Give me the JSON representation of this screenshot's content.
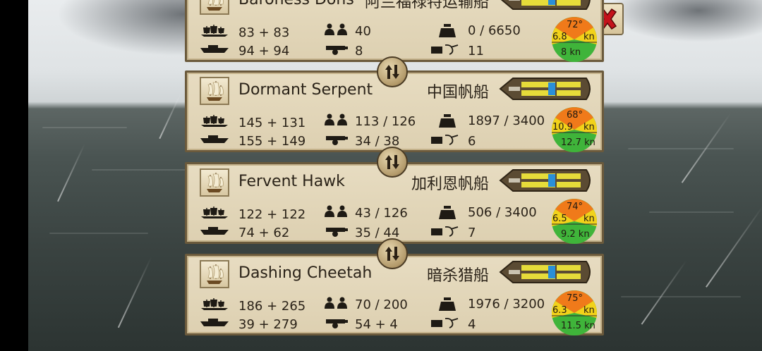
{
  "close": {
    "icon": "close-x-icon"
  },
  "ships": [
    {
      "name": "Baroness Dons",
      "type": "阿兰福禄特运输船",
      "crew_cur": "83 + 83",
      "hull_cur": "94 + 94",
      "sailors": "40",
      "cannons": "8",
      "cargo": "0 / 6650",
      "supplies": "11",
      "angle": "72°",
      "speed_low": "6.8",
      "speed_unit": "kn",
      "speed_max": "8 kn"
    },
    {
      "name": "Dormant Serpent",
      "type": "中国帆船",
      "crew_cur": "145 + 131",
      "hull_cur": "155 + 149",
      "sailors": "113 / 126",
      "cannons": "34 / 38",
      "cargo": "1897 / 3400",
      "supplies": "6",
      "angle": "68°",
      "speed_low": "10.9",
      "speed_unit": "kn",
      "speed_max": "12.7 kn"
    },
    {
      "name": "Fervent Hawk",
      "type": "加利恩帆船",
      "crew_cur": "122 + 122",
      "hull_cur": "74 + 62",
      "sailors": "43 / 126",
      "cannons": "35 / 44",
      "cargo": "506 / 3400",
      "supplies": "7",
      "angle": "74°",
      "speed_low": "6.5",
      "speed_unit": "kn",
      "speed_max": "9.2 kn"
    },
    {
      "name": "Dashing Cheetah",
      "type": "暗杀猎船",
      "crew_cur": "186 + 265",
      "hull_cur": "39 + 279",
      "sailors": "70 / 200",
      "cannons": "54 + 4",
      "cargo": "1976 / 3200",
      "supplies": "4",
      "angle": "75°",
      "speed_low": "6.3",
      "speed_unit": "kn",
      "speed_max": "11.5 kn"
    }
  ],
  "colors": {
    "panel_bg": "#e3d8bc",
    "panel_border": "#6b5a3c",
    "speed_orange": "#f07a1a",
    "speed_yellow": "#f2d21a",
    "speed_green": "#3fb43a"
  }
}
